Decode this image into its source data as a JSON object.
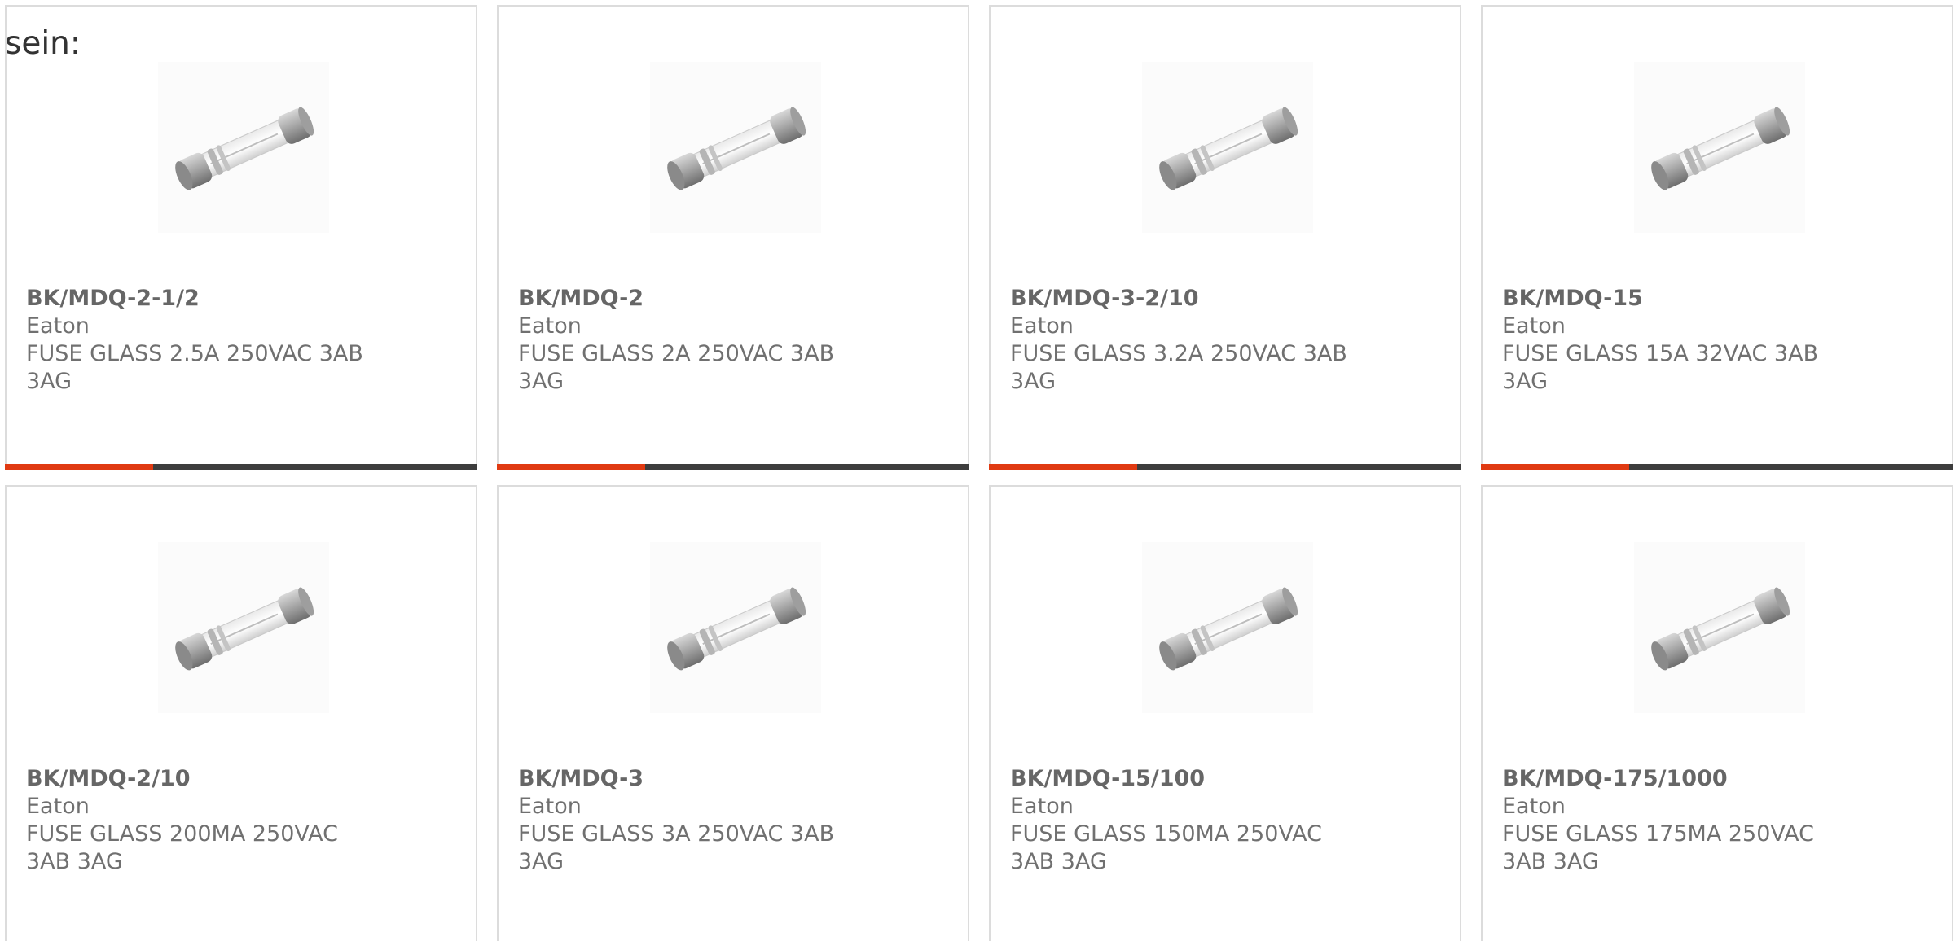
{
  "intro_text": "sein:",
  "accent_color": "#e03a12",
  "bar_color": "#3d3d3d",
  "products": [
    {
      "part_number": "BK/MDQ-2-1/2",
      "manufacturer": "Eaton",
      "description": "FUSE GLASS 2.5A 250VAC 3AB 3AG",
      "image_icon": "glass-fuse-icon"
    },
    {
      "part_number": "BK/MDQ-2",
      "manufacturer": "Eaton",
      "description": "FUSE GLASS 2A 250VAC 3AB 3AG",
      "image_icon": "glass-fuse-icon"
    },
    {
      "part_number": "BK/MDQ-3-2/10",
      "manufacturer": "Eaton",
      "description": "FUSE GLASS 3.2A 250VAC 3AB 3AG",
      "image_icon": "glass-fuse-icon"
    },
    {
      "part_number": "BK/MDQ-15",
      "manufacturer": "Eaton",
      "description": "FUSE GLASS 15A 32VAC 3AB 3AG",
      "image_icon": "glass-fuse-icon"
    },
    {
      "part_number": "BK/MDQ-2/10",
      "manufacturer": "Eaton",
      "description": "FUSE GLASS 200MA 250VAC 3AB 3AG",
      "image_icon": "glass-fuse-icon"
    },
    {
      "part_number": "BK/MDQ-3",
      "manufacturer": "Eaton",
      "description": "FUSE GLASS 3A 250VAC 3AB 3AG",
      "image_icon": "glass-fuse-icon"
    },
    {
      "part_number": "BK/MDQ-15/100",
      "manufacturer": "Eaton",
      "description": "FUSE GLASS 150MA 250VAC 3AB 3AG",
      "image_icon": "glass-fuse-icon"
    },
    {
      "part_number": "BK/MDQ-175/1000",
      "manufacturer": "Eaton",
      "description": "FUSE GLASS 175MA 250VAC 3AB 3AG",
      "image_icon": "glass-fuse-icon"
    }
  ]
}
